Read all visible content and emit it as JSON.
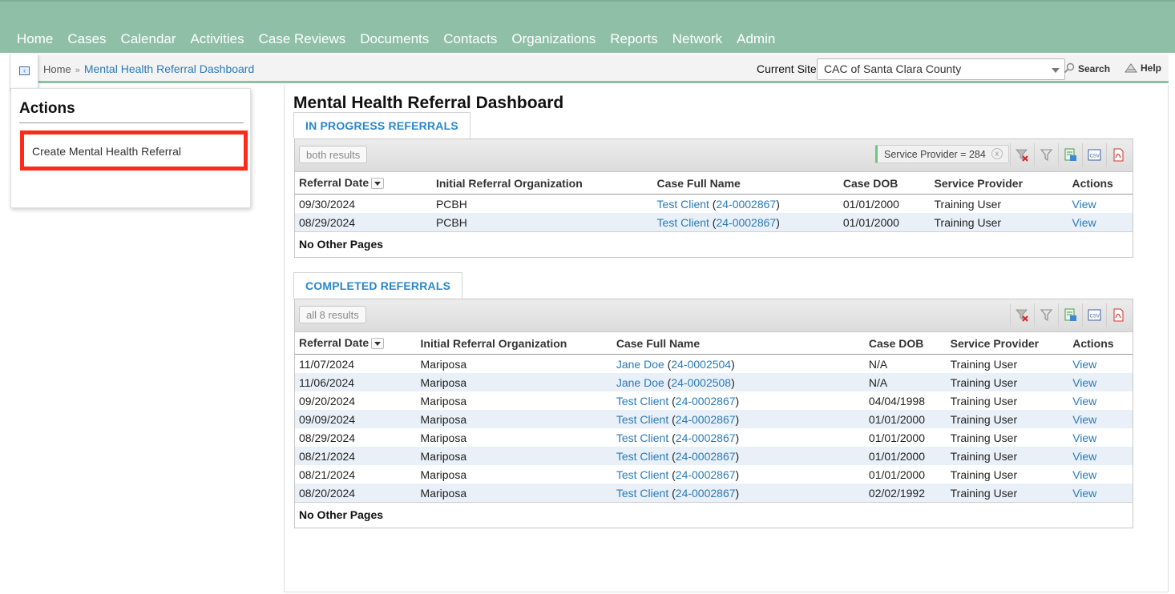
{
  "nav": [
    "Home",
    "Cases",
    "Calendar",
    "Activities",
    "Case Reviews",
    "Documents",
    "Contacts",
    "Organizations",
    "Reports",
    "Network",
    "Admin"
  ],
  "breadcrumb": {
    "home": "Home",
    "sep": "»",
    "current": "Mental Health Referral Dashboard"
  },
  "site": {
    "label": "Current Site",
    "value": "CAC of Santa Clara County"
  },
  "search_label": "Search",
  "help_label": "Help",
  "actions": {
    "title": "Actions",
    "create_label": "Create Mental Health Referral"
  },
  "page_title": "Mental Health Referral Dashboard",
  "in_progress": {
    "tab": "IN PROGRESS REFERRALS",
    "results": "both results",
    "filter_chip": "Service Provider = 284",
    "columns": [
      "Referral Date",
      "Initial Referral Organization",
      "Case Full Name",
      "Case DOB",
      "Service Provider",
      "Actions"
    ],
    "rows": [
      {
        "date": "09/30/2024",
        "org": "PCBH",
        "name": "Test Client",
        "case_id": "24-0002867",
        "dob": "01/01/2000",
        "provider": "Training User",
        "action": "View"
      },
      {
        "date": "08/29/2024",
        "org": "PCBH",
        "name": "Test Client",
        "case_id": "24-0002867",
        "dob": "01/01/2000",
        "provider": "Training User",
        "action": "View"
      }
    ],
    "pager": "No Other Pages"
  },
  "completed": {
    "tab": "COMPLETED REFERRALS",
    "results": "all 8 results",
    "columns": [
      "Referral Date",
      "Initial Referral Organization",
      "Case Full Name",
      "Case DOB",
      "Service Provider",
      "Actions"
    ],
    "rows": [
      {
        "date": "11/07/2024",
        "org": "Mariposa",
        "name": "Jane Doe",
        "case_id": "24-0002504",
        "dob": "N/A",
        "provider": "Training User",
        "action": "View"
      },
      {
        "date": "11/06/2024",
        "org": "Mariposa",
        "name": "Jane Doe",
        "case_id": "24-0002508",
        "dob": "N/A",
        "provider": "Training User",
        "action": "View"
      },
      {
        "date": "09/20/2024",
        "org": "Mariposa",
        "name": "Test Client",
        "case_id": "24-0002867",
        "dob": "04/04/1998",
        "provider": "Training User",
        "action": "View"
      },
      {
        "date": "09/09/2024",
        "org": "Mariposa",
        "name": "Test Client",
        "case_id": "24-0002867",
        "dob": "01/01/2000",
        "provider": "Training User",
        "action": "View"
      },
      {
        "date": "08/29/2024",
        "org": "Mariposa",
        "name": "Test Client",
        "case_id": "24-0002867",
        "dob": "01/01/2000",
        "provider": "Training User",
        "action": "View"
      },
      {
        "date": "08/21/2024",
        "org": "Mariposa",
        "name": "Test Client",
        "case_id": "24-0002867",
        "dob": "01/01/2000",
        "provider": "Training User",
        "action": "View"
      },
      {
        "date": "08/21/2024",
        "org": "Mariposa",
        "name": "Test Client",
        "case_id": "24-0002867",
        "dob": "01/01/2000",
        "provider": "Training User",
        "action": "View"
      },
      {
        "date": "08/20/2024",
        "org": "Mariposa",
        "name": "Test Client",
        "case_id": "24-0002867",
        "dob": "02/02/1992",
        "provider": "Training User",
        "action": "View"
      }
    ],
    "pager": "No Other Pages"
  },
  "toolbar_icons": [
    "clear-filter-icon",
    "filter-icon",
    "excel-export-icon",
    "csv-export-icon",
    "pdf-export-icon"
  ],
  "colors": {
    "nav_bg": "#8fbfa7",
    "link": "#2a7ab8",
    "highlight_border": "#ff2a1a",
    "row_alt": "#e9f0f8"
  }
}
